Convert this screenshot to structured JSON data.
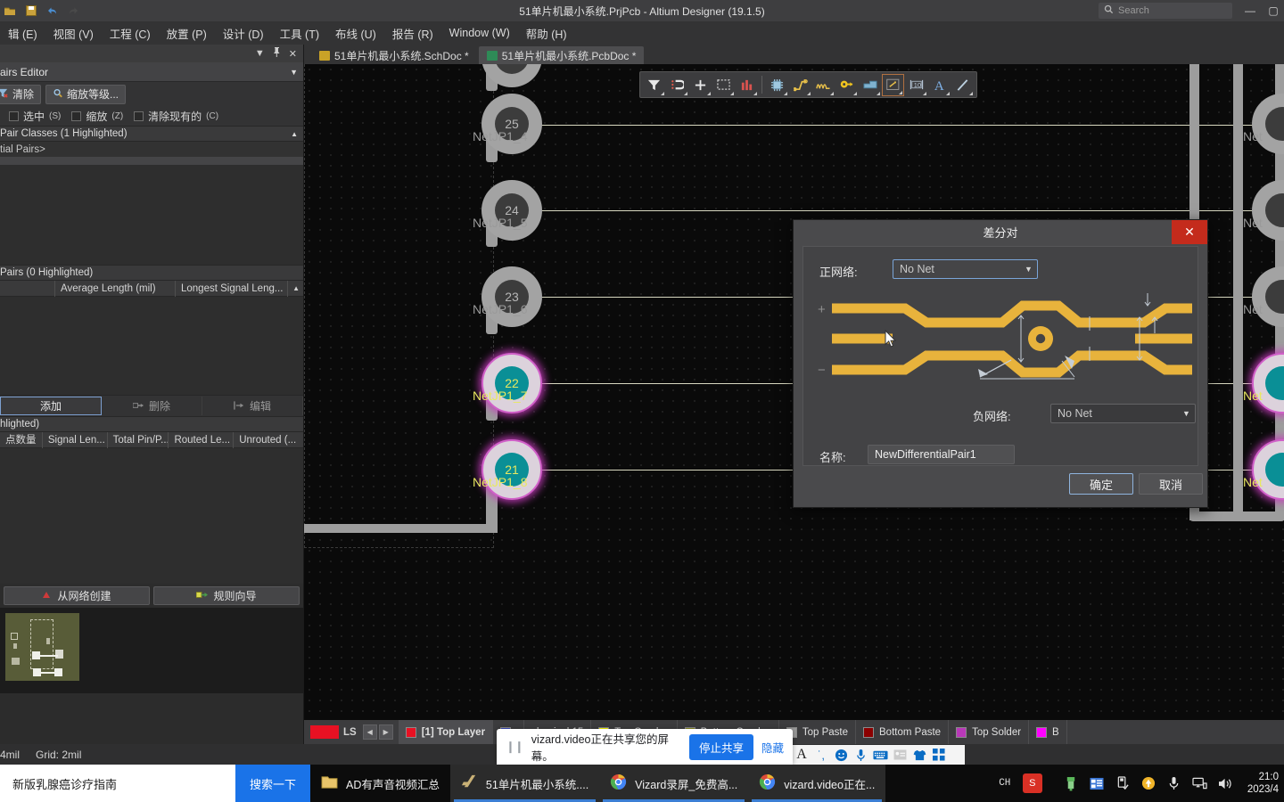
{
  "titlebar": {
    "title": "51单片机最小系统.PrjPcb - Altium Designer (19.1.5)",
    "search_placeholder": "Search",
    "icons": [
      "open-icon",
      "save-icon",
      "undo-icon",
      "redo-icon"
    ],
    "minimize": "—",
    "maximize": "▢",
    "close": "✕"
  },
  "menubar": {
    "items": [
      {
        "label": "辑 (E)",
        "name": "menu-edit"
      },
      {
        "label": "视图 (V)",
        "name": "menu-view"
      },
      {
        "label": "工程 (C)",
        "name": "menu-project"
      },
      {
        "label": "放置 (P)",
        "name": "menu-place"
      },
      {
        "label": "设计 (D)",
        "name": "menu-design"
      },
      {
        "label": "工具 (T)",
        "name": "menu-tools"
      },
      {
        "label": "布线 (U)",
        "name": "menu-route"
      },
      {
        "label": "报告 (R)",
        "name": "menu-report"
      },
      {
        "label": "Window (W)",
        "name": "menu-window"
      },
      {
        "label": "帮助 (H)",
        "name": "menu-help"
      }
    ]
  },
  "left_panel": {
    "panel_title": "Pairs Editor",
    "toolbar": {
      "clear_label": "清除",
      "zoom_level_label": "缩放等级..."
    },
    "checkboxes": [
      {
        "label": "选中",
        "accel": "(S)",
        "checked": false
      },
      {
        "label": "缩放",
        "accel": "(Z)",
        "checked": false
      },
      {
        "label": "清除现有的",
        "accel": "(C)",
        "checked": false
      }
    ],
    "classes_section": "Pair Classes (1 Highlighted)",
    "classes_rows": [
      "tial Pairs>",
      ""
    ],
    "pairs_section": "Pairs (0 Highlighted)",
    "pairs_columns": [
      "Average Length (mil)",
      "Longest Signal Leng..."
    ],
    "action_buttons": [
      {
        "label": "添加",
        "name": "add-button",
        "enabled": true
      },
      {
        "label": "删除",
        "name": "delete-button",
        "enabled": false
      },
      {
        "label": "编辑",
        "name": "edit-button",
        "enabled": false
      }
    ],
    "nets_section": "hlighted)",
    "nets_columns": [
      "点数量",
      "Signal Len...",
      "Total Pin/P...",
      "Routed Le...",
      "Unrouted (..."
    ],
    "bottom_buttons": [
      {
        "label": "从网络创建",
        "name": "create-from-nets-button"
      },
      {
        "label": "规则向导",
        "name": "rule-wizard-button"
      }
    ]
  },
  "doc_tabs": [
    {
      "label": "51单片机最小系统.SchDoc *",
      "active": false,
      "color": "#c9a227"
    },
    {
      "label": "51单片机最小系统.PcbDoc *",
      "active": true,
      "color": "#2e8b57"
    }
  ],
  "canvas_toolbar": {
    "tools": [
      {
        "name": "filter-icon",
        "glyph": "filter"
      },
      {
        "name": "magnet-icon",
        "glyph": "magnet"
      },
      {
        "name": "crosshair-icon",
        "glyph": "cross"
      },
      {
        "name": "select-area-icon",
        "glyph": "dashedbox"
      },
      {
        "name": "chart-icon",
        "glyph": "bars"
      },
      {
        "name": "component-icon",
        "glyph": "chip"
      },
      {
        "name": "route-icon",
        "glyph": "route"
      },
      {
        "name": "wave-route-icon",
        "glyph": "wave"
      },
      {
        "name": "via-icon",
        "glyph": "via"
      },
      {
        "name": "polygon-icon",
        "glyph": "poly"
      },
      {
        "name": "dimension-icon",
        "glyph": "arrowbox"
      },
      {
        "name": "measure-icon",
        "glyph": "measure"
      },
      {
        "name": "text-icon",
        "glyph": "A"
      },
      {
        "name": "line-icon",
        "glyph": "line"
      }
    ]
  },
  "pcb_pads": [
    {
      "num": "25",
      "net": "NetJP1_4",
      "selected": false
    },
    {
      "num": "24",
      "net": "NetJP1_5",
      "selected": false
    },
    {
      "num": "23",
      "net": "NetJP1_6",
      "selected": false
    },
    {
      "num": "22",
      "net": "NetJP1_7",
      "selected": true
    },
    {
      "num": "21",
      "net": "NetJP1_8",
      "selected": true
    }
  ],
  "pcb_pads_right": [
    {
      "net": "Net",
      "selected": false
    },
    {
      "net": "Net",
      "selected": false
    },
    {
      "net": "Net",
      "selected": false
    },
    {
      "net": "Net",
      "selected": true
    },
    {
      "net": "Net",
      "selected": true
    }
  ],
  "dialog": {
    "title": "差分对",
    "close_glyph": "✕",
    "positive_net_label": "正网络:",
    "positive_net_value": "No Net",
    "negative_net_label": "负网络:",
    "negative_net_value": "No Net",
    "name_label": "名称:",
    "name_value": "NewDifferentialPair1",
    "ok_label": "确定",
    "cancel_label": "取消",
    "trace_color": "#e8b33c",
    "plus_marker": "+",
    "minus_marker": "−"
  },
  "layerbar": {
    "ls_label": "LS",
    "ls_color": "#e81123",
    "prev_glyph": "◀",
    "next_glyph": "▶",
    "tabs": [
      {
        "label": "[1] Top Layer",
        "color": "#e81123",
        "active": true
      },
      {
        "label": "",
        "color": "#3b4cc0",
        "active": false
      },
      {
        "label": "chanical 15",
        "color": "",
        "active": false
      },
      {
        "label": "Top Overlay",
        "color": "#ffff00",
        "active": false
      },
      {
        "label": "Bottom Overlay",
        "color": "#8a8a1e",
        "active": false
      },
      {
        "label": "Top Paste",
        "color": "#9a9a9a",
        "active": false
      },
      {
        "label": "Bottom Paste",
        "color": "#8b0000",
        "active": false
      },
      {
        "label": "Top Solder",
        "color": "#b838b8",
        "active": false
      },
      {
        "label": "B",
        "color": "#ff00ff",
        "active": false
      }
    ]
  },
  "statusbar": {
    "snap": "4mil",
    "grid": "Grid: 2mil"
  },
  "share_toast": {
    "text": "vizard.video正在共享您的屏幕。",
    "stop_label": "停止共享",
    "hide_label": "隐藏"
  },
  "ime_toolbar": {
    "icons": [
      "letter-a-icon",
      "punctuation-icon",
      "emoji-icon",
      "microphone-icon",
      "keyboard-icon",
      "contact-card-icon",
      "shirt-icon",
      "apps-icon"
    ]
  },
  "taskbar": {
    "search_text": "新版乳腺癌诊疗指南",
    "search_button": "搜索一下",
    "items": [
      {
        "label": "AD有声音视频汇总",
        "name": "taskbar-folder",
        "icon": "folder-icon",
        "running": false
      },
      {
        "label": "51单片机最小系统....",
        "name": "taskbar-altium",
        "icon": "altium-icon",
        "running": true
      },
      {
        "label": "Vizard录屏_免费高...",
        "name": "taskbar-vizard1",
        "icon": "chrome-icon",
        "running": true
      },
      {
        "label": "vizard.video正在...",
        "name": "taskbar-vizard2",
        "icon": "chrome-icon",
        "running": true
      }
    ],
    "tray": {
      "ime": "CH",
      "sogou": "S",
      "icons": [
        "usb-icon",
        "media-icon",
        "safe-eject-icon",
        "update-icon",
        "microphone-icon",
        "network-icon",
        "volume-icon"
      ],
      "time": "21:0",
      "date": "2023/4"
    }
  }
}
